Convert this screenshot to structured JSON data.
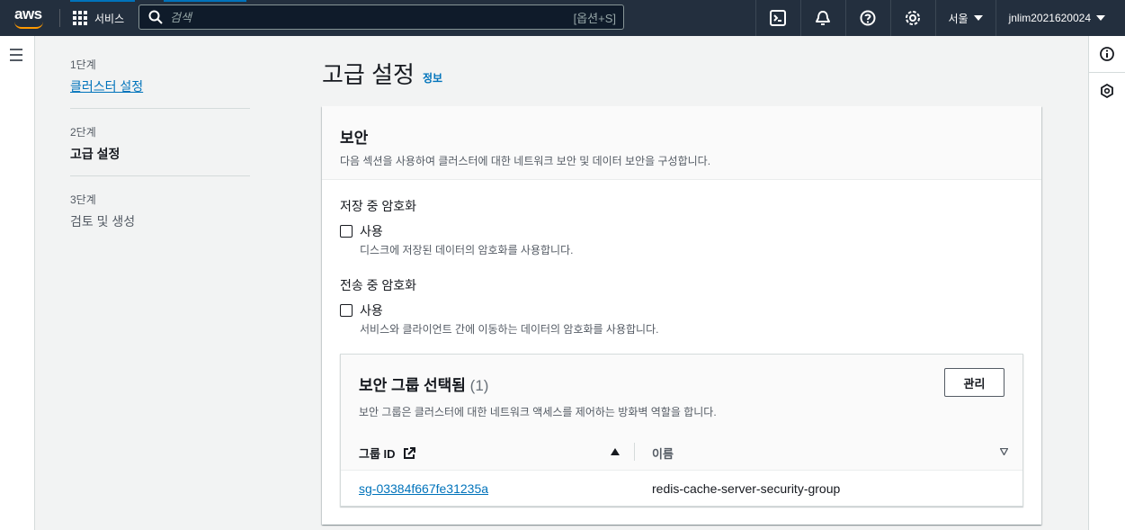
{
  "nav": {
    "logo_text": "aws",
    "services_label": "서비스",
    "search_placeholder": "검색",
    "search_shortcut": "[옵션+S]",
    "region": "서울",
    "account": "jnlim2021620024"
  },
  "steps": [
    {
      "label": "1단계",
      "title": "클러스터 설정"
    },
    {
      "label": "2단계",
      "title": "고급 설정"
    },
    {
      "label": "3단계",
      "title": "검토 및 생성"
    }
  ],
  "page": {
    "title": "고급 설정",
    "info": "정보"
  },
  "security_panel": {
    "title": "보안",
    "description": "다음 섹션을 사용하여 클러스터에 대한 네트워크 보안 및 데이터 보안을 구성합니다.",
    "at_rest": {
      "label": "저장 중 암호화",
      "checkbox_label": "사용",
      "checkbox_desc": "디스크에 저장된 데이터의 암호화를 사용합니다."
    },
    "in_transit": {
      "label": "전송 중 암호화",
      "checkbox_label": "사용",
      "checkbox_desc": "서비스와 클라이언트 간에 이동하는 데이터의 암호화를 사용합니다."
    }
  },
  "security_groups": {
    "title": "보안 그룹 선택됨",
    "count": "(1)",
    "description": "보안 그룹은 클러스터에 대한 네트워크 액세스를 제어하는 방화벽 역할을 합니다.",
    "manage_label": "관리",
    "col_id": "그룹 ID",
    "col_name": "이름",
    "rows": [
      {
        "id": "sg-03384f667fe31235a",
        "name": "redis-cache-server-security-group"
      }
    ]
  }
}
